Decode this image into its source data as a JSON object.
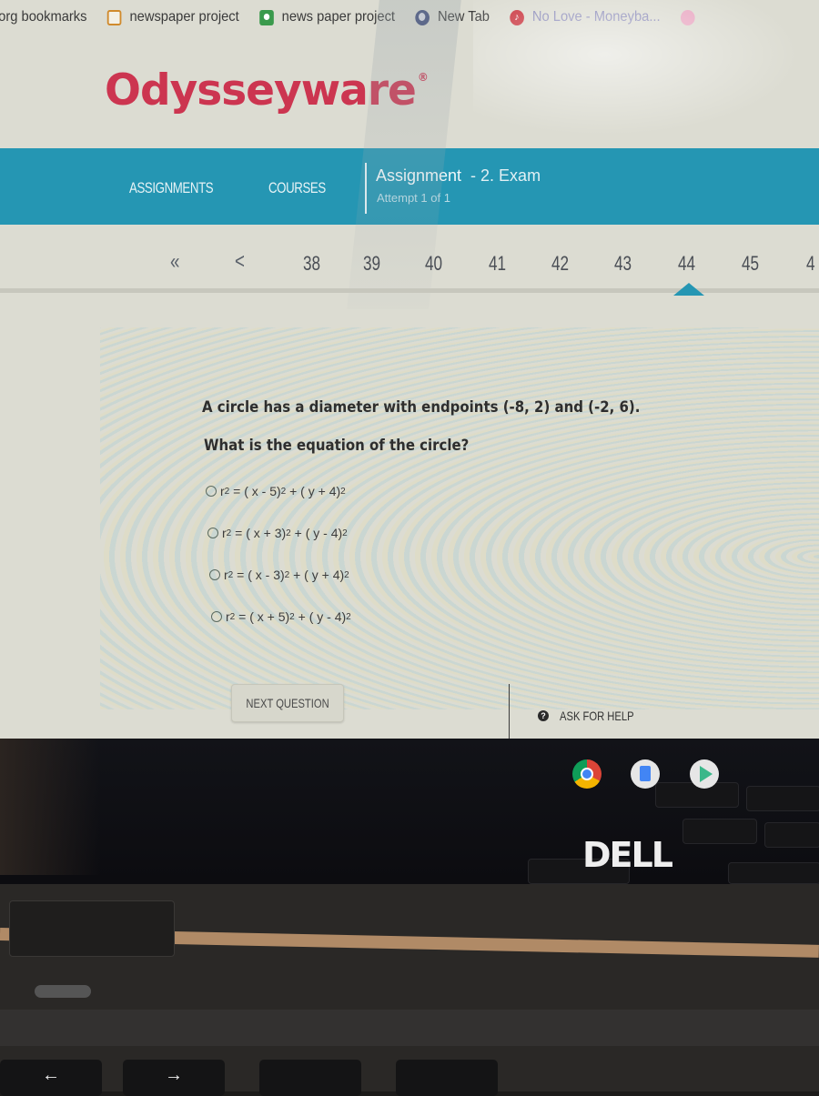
{
  "bookmarks": [
    {
      "label": "org bookmarks",
      "icon": "none"
    },
    {
      "label": "newspaper project",
      "icon": "folder-icon"
    },
    {
      "label": "news paper project",
      "icon": "classroom-icon"
    },
    {
      "label": "New Tab",
      "icon": "globe-icon"
    },
    {
      "label": "No Love - Moneyba...",
      "icon": "music-icon"
    }
  ],
  "logo": {
    "text": "Odysseyware",
    "mark": "®"
  },
  "nav": {
    "assignments": "ASSIGNMENTS",
    "courses": "COURSES",
    "assignment_title": "Assignment",
    "assignment_name": "- 2. Exam",
    "attempt": "Attempt 1 of 1"
  },
  "pager": {
    "first": "«",
    "prev": "<",
    "pages": [
      "38",
      "39",
      "40",
      "41",
      "42",
      "43",
      "44",
      "45",
      "4"
    ],
    "current": "44"
  },
  "question": {
    "text": "A circle has a diameter with endpoints (-8, 2) and (-2, 6).",
    "prompt": "What is the equation of the circle?",
    "options": [
      {
        "lhs": "r",
        "a": "x - 5",
        "b": "y + 4"
      },
      {
        "lhs": "r",
        "a": "x + 3",
        "b": "y - 4"
      },
      {
        "lhs": "r",
        "a": "x - 3",
        "b": "y + 4"
      },
      {
        "lhs": "r",
        "a": "x + 5",
        "b": "y - 4"
      }
    ]
  },
  "footer": {
    "next": "NEXT QUESTION",
    "help": "ASK FOR HELP",
    "help_icon": "?"
  },
  "device": {
    "brand": "DELL",
    "shelf_apps": [
      "chrome-icon",
      "docs-icon",
      "play-store-icon"
    ],
    "keys": [
      "←",
      "→"
    ]
  },
  "colors": {
    "brand": "#cc3550",
    "nav": "#2596b3"
  }
}
